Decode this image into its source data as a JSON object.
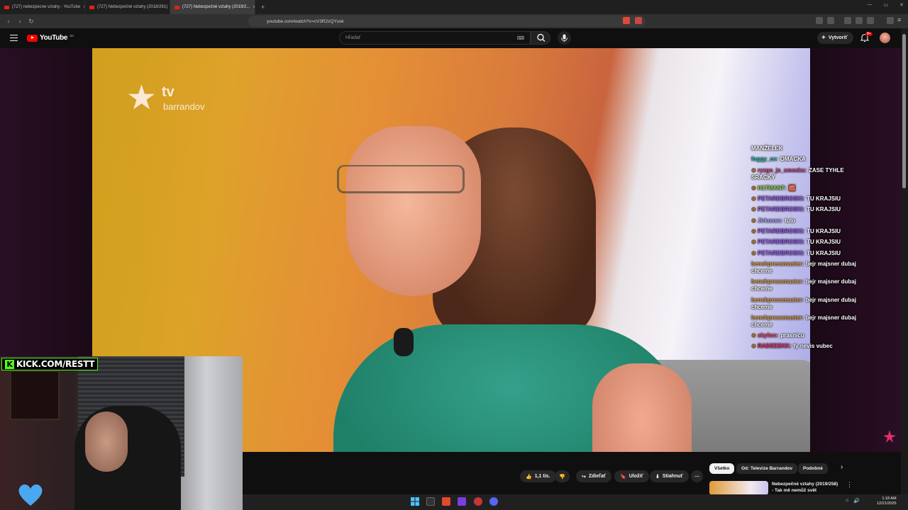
{
  "browser": {
    "tabs": [
      {
        "label": "(727) nebezpecne vztahy - YouTube",
        "active": false
      },
      {
        "label": "(727) Nebezpečné vztahy (2018/261)",
        "active": false
      },
      {
        "label": "(727) Nebezpečné vztahy (2019/2...",
        "active": true
      }
    ],
    "url": "youtube.com/watch?v=cV3R2zQYusk"
  },
  "header": {
    "logo_text": "YouTube",
    "logo_region": "SK",
    "search_placeholder": "Hľadať",
    "create_label": "Vytvoriť",
    "notification_count": "9+"
  },
  "video": {
    "channel_logo_tv": "tv",
    "channel_logo_name": "barrandov"
  },
  "chat": {
    "messages": [
      {
        "user": "",
        "user_color": "#ffffff",
        "text": "MANŽELEK",
        "badge": false
      },
      {
        "user": "foggy_ce",
        "user_color": "#2ec4b6",
        "text": "OMACKA",
        "badge": false
      },
      {
        "user": "ryzgo_je_smeeks",
        "user_color": "#c74e8b",
        "text": "ZASE TYHLE SRACKY",
        "badge": true
      },
      {
        "user": "H1TMAN7",
        "user_color": "#8bd44a",
        "text": "🧱",
        "badge": true
      },
      {
        "user": "PETARDBROSKI",
        "user_color": "#9a5cf0",
        "text": "TU KRAJSIU",
        "badge": true
      },
      {
        "user": "PETARDBROSKI",
        "user_color": "#9a5cf0",
        "text": "TU KRAJSIU",
        "badge": true
      },
      {
        "user": "Jirkosss",
        "user_color": "#b0a8ff",
        "text": "tuto",
        "badge": true
      },
      {
        "user": "PETARDBROSKI",
        "user_color": "#9a5cf0",
        "text": "TU KRAJSIU",
        "badge": true
      },
      {
        "user": "PETARDBROSKI",
        "user_color": "#9a5cf0",
        "text": "TU KRAJSIU",
        "badge": true
      },
      {
        "user": "PETARDBROSKI",
        "user_color": "#9a5cf0",
        "text": "TU KRAJSIU",
        "badge": true
      },
      {
        "user": "benchpressmaster",
        "user_color": "#e0a04a",
        "text": "bejr majsner dubaj chceme",
        "badge": false
      },
      {
        "user": "benchpressmaster",
        "user_color": "#e0a04a",
        "text": "bejr majsner dubaj chceme",
        "badge": false
      },
      {
        "user": "benchpressmaster",
        "user_color": "#e0a04a",
        "text": "bejr majsner dubaj chceme",
        "badge": false
      },
      {
        "user": "benchpressmaster",
        "user_color": "#e0a04a",
        "text": "bejr majsner dubaj chceme",
        "badge": false
      },
      {
        "user": "skyfwc",
        "user_color": "#e84a6a",
        "text": "prasnicu",
        "badge": true
      },
      {
        "user": "RADEEEKK",
        "user_color": "#e0306a",
        "text": "ty nevis vubec",
        "badge": true
      }
    ]
  },
  "webcam": {
    "kick_url": "KICK.COM/RESTT",
    "kick_letter": "K"
  },
  "actions": {
    "like_count": "1,1 tis.",
    "share_label": "Zdieľať",
    "save_label": "Uložiť",
    "download_label": "Stiahnuť"
  },
  "chips": [
    {
      "label": "Všetko",
      "selected": true
    },
    {
      "label": "Od: Televize Barrandov",
      "selected": false
    },
    {
      "label": "Podobné",
      "selected": false
    }
  ],
  "recommendation": {
    "title_line1": "Nebezpečné vztahy (2019/258)",
    "title_line2": "- Tak mě nemůž svět"
  },
  "taskbar": {
    "time": "1:18 AM",
    "date": "12/21/2025"
  },
  "colors": {
    "accent_red": "#ff0000",
    "kick_green": "#53fc18"
  }
}
